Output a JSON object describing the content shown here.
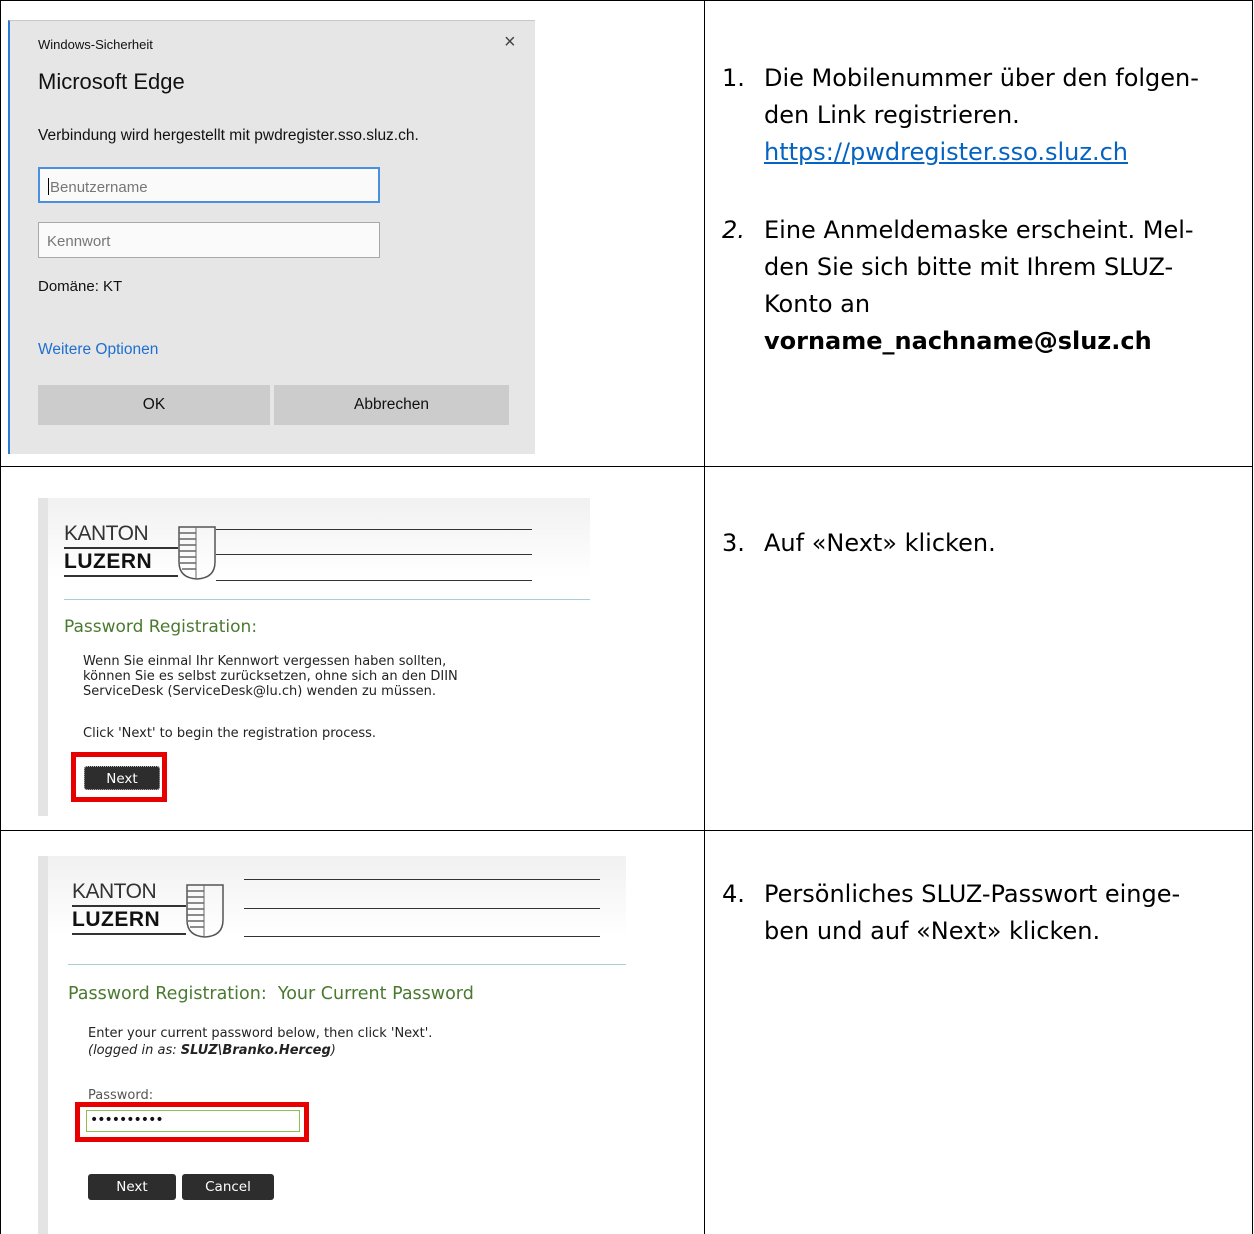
{
  "steps": [
    {
      "number": "1.",
      "lines": [
        "Die Mobilenummer über den folgen-",
        "den Link registrieren."
      ],
      "link": "https://pwdregister.sso.sluz.ch"
    },
    {
      "number": "2.",
      "lines": [
        "Eine Anmeldemaske erscheint. Mel-",
        "den Sie sich bitte mit Ihrem SLUZ-",
        "Konto an"
      ],
      "bold": "vorname_nachname@sluz.ch"
    },
    {
      "number": "3.",
      "lines": [
        "Auf «Next» klicken."
      ]
    },
    {
      "number": "4.",
      "lines": [
        "Persönliches SLUZ-Passwort einge-",
        "ben und auf «Next» klicken."
      ]
    }
  ],
  "dialog": {
    "window_title": "Windows-Sicherheit",
    "close": "×",
    "app_name": "Microsoft Edge",
    "connecting": "Verbindung wird hergestellt mit pwdregister.sso.sluz.ch.",
    "username_placeholder": "Benutzername",
    "password_placeholder": "Kennwort",
    "domain": "Domäne: KT",
    "more_options": "Weitere Optionen",
    "ok": "OK",
    "cancel": "Abbrechen"
  },
  "logo": {
    "line1": "KANTON",
    "line2": "LUZERN"
  },
  "panel1": {
    "title": "Password Registration:",
    "text_lines": [
      "Wenn Sie einmal Ihr Kennwort vergessen haben sollten,",
      "können Sie es selbst zurücksetzen, ohne sich an den DIIN",
      "ServiceDesk (ServiceDesk@lu.ch) wenden zu müssen."
    ],
    "instruction": "Click 'Next' to begin the registration process.",
    "next": "Next"
  },
  "panel2": {
    "title": "Password Registration:  Your Current Password",
    "instruction": "Enter your current password below, then click 'Next'.",
    "logged_prefix": "(logged in as: ",
    "logged_user": "SLUZ\\Branko.Herceg",
    "logged_suffix": ")",
    "password_label": "Password:",
    "password_value": "••••••••••",
    "next": "Next",
    "cancel": "Cancel"
  },
  "colors": {
    "link": "#0563c1",
    "highlight": "#e60000",
    "title_green": "#4a7a30",
    "dialog_accent": "#2b79d8"
  }
}
